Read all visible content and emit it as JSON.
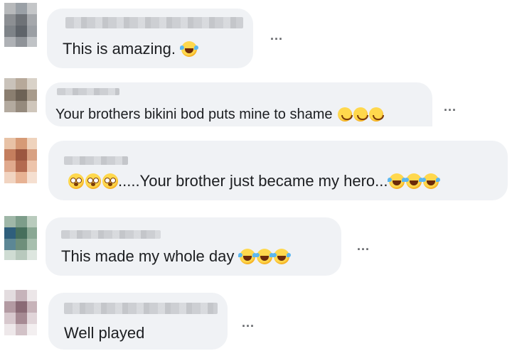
{
  "comments": [
    {
      "text": "This is amazing.",
      "more": "..."
    },
    {
      "text": "Your brothers bikini bod puts mine to shame",
      "more": "..."
    },
    {
      "text": ".....Your brother just became my hero...",
      "more": "..."
    },
    {
      "text": "This made my whole day",
      "more": "..."
    },
    {
      "text": "Well played",
      "more": "..."
    }
  ],
  "icons": {
    "emoji_laughing": "face-with-tears-of-joy-icon",
    "emoji_smile": "smiling-face-icon",
    "emoji_flushed": "flushed-face-icon",
    "more": "more-options-icon"
  },
  "colors": {
    "bubble": "#f0f2f5",
    "text": "#1c1e21",
    "more": "#65676b"
  }
}
